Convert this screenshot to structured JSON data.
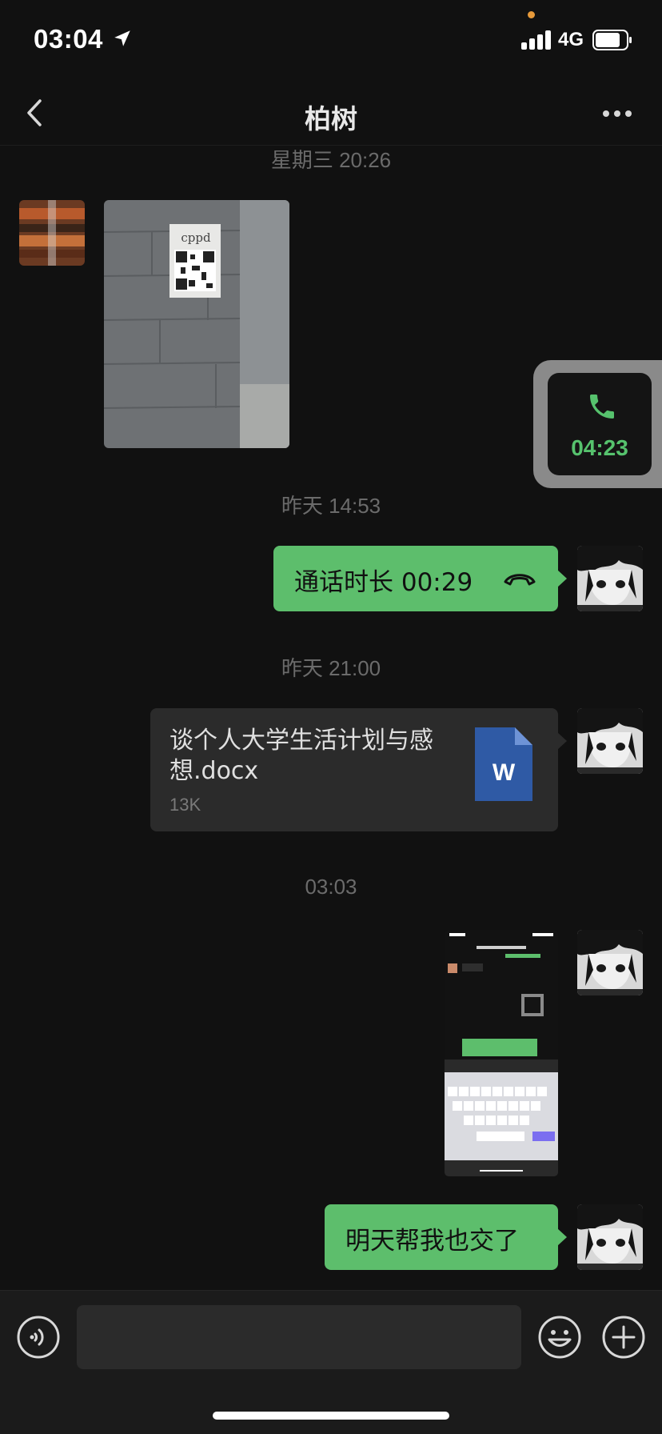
{
  "status_bar": {
    "time": "03:04",
    "network": "4G",
    "battery_level": 0.75
  },
  "nav": {
    "title": "柏树"
  },
  "messages": {
    "ts1": "星期三 20:26",
    "photo": {
      "sign_text": "cppd"
    },
    "ts2": "昨天 14:53",
    "call": {
      "text": "通话时长 00:29"
    },
    "ts3": "昨天 21:00",
    "file": {
      "name": "谈个人大学生活计划与感想.docx",
      "size": "13K",
      "icon_letter": "W"
    },
    "ts4": "03:03",
    "text": "明天帮我也交了"
  },
  "floating_call": {
    "timer": "04:23"
  },
  "input": {
    "value": "",
    "placeholder": ""
  },
  "colors": {
    "accent_green": "#5dbe6c",
    "background": "#111111",
    "bubble_gray": "#2b2b2b",
    "word_blue": "#2b579a"
  }
}
